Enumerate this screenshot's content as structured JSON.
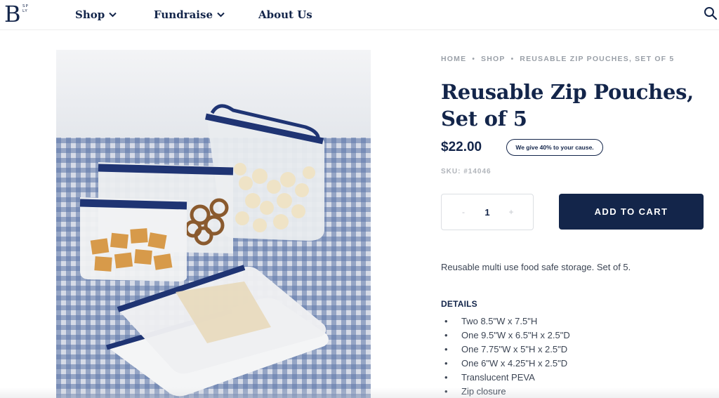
{
  "header": {
    "logo_letter": "B",
    "logo_small_top": "SP",
    "logo_small_bottom": "LY",
    "nav": [
      {
        "label": "Shop"
      },
      {
        "label": "Fundraise"
      },
      {
        "label": "About Us"
      }
    ],
    "search_icon": "search-icon"
  },
  "breadcrumb": {
    "home": "HOME",
    "shop": "SHOP",
    "current": "REUSABLE ZIP POUCHES, SET OF 5",
    "separator": "•"
  },
  "product": {
    "title": "Reusable Zip Pouches, Set of 5",
    "price": "$22.00",
    "badge": "We give 40% to your cause.",
    "sku": "SKU: #14046",
    "quantity": {
      "minus": "-",
      "value": "1",
      "plus": "+"
    },
    "add_to_cart": "ADD TO CART",
    "description": "Reusable multi use food safe storage. Set of 5.",
    "details_heading": "DETAILS",
    "details": [
      "Two 8.5\"W x 7.5\"H",
      "One 9.5\"W x 6.5\"H x 2.5\"D",
      "One 7.75\"W x 5\"H x 2.5\"D",
      "One 6\"W x 4.25\"H x 2.5\"D",
      "Translucent PEVA",
      "Zip closure"
    ],
    "bullet": "•"
  },
  "colors": {
    "navy": "#13254a",
    "muted": "#9aa0a8"
  }
}
